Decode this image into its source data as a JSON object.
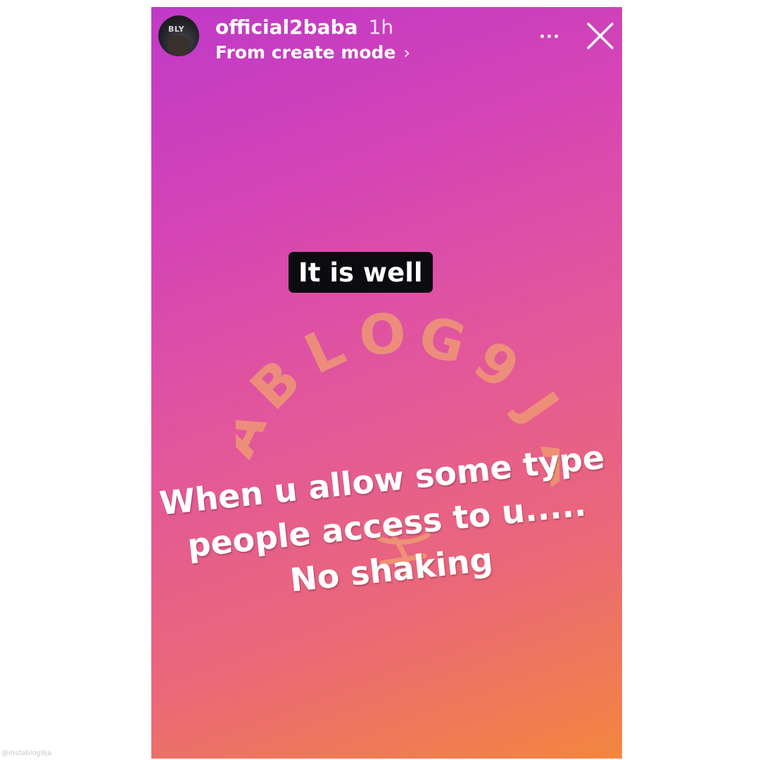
{
  "story": {
    "username": "official2baba",
    "time": "1h",
    "subtitle": "From create mode",
    "subtitle_chevron": "›",
    "avatar_label": "BLY",
    "sticker_text": "It is well",
    "caption_lines": [
      "When u allow some type",
      "people access to u.....",
      "No shaking"
    ],
    "watermark_text": "ABLOG9JA",
    "watermark_letters": [
      "A",
      "B",
      "L",
      "O",
      "G",
      "9",
      "J",
      "A"
    ]
  },
  "credit": "@instablog9ja",
  "icons": {
    "more": "more-horizontal-icon",
    "close": "close-icon"
  },
  "colors": {
    "gradient_top": "#c039c8",
    "gradient_mid": "#e2579b",
    "gradient_bottom": "#f3863f",
    "sticker_bg": "#0c0c10",
    "watermark": "#f0a070"
  }
}
